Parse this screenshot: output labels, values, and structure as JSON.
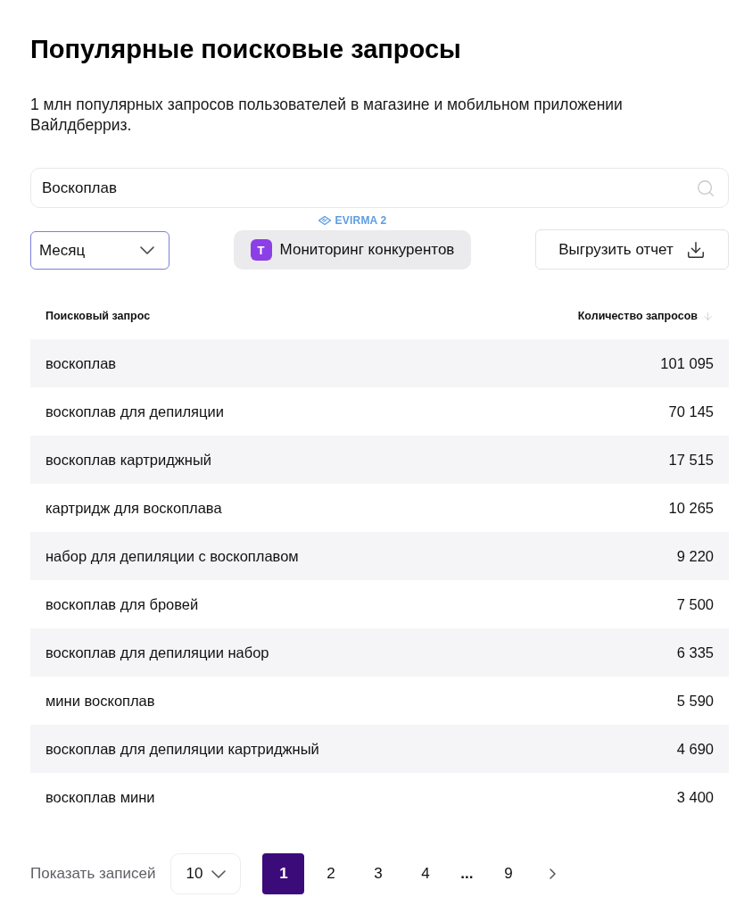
{
  "title": "Популярные поисковые запросы",
  "description": "1 млн популярных запросов пользователей в магазине и мобильном приложении Вайлдберриз.",
  "search": {
    "value": "Воскоплав"
  },
  "controls": {
    "period_select": {
      "value": "Месяц",
      "focused": true
    },
    "promo_label": "EVIRMA 2",
    "monitoring_button": {
      "badge": "T",
      "label": "Мониторинг конкурентов"
    },
    "export_button": {
      "label": "Выгрузить отчет"
    }
  },
  "table": {
    "columns": [
      {
        "label": "Поисковый запрос",
        "sorted": false
      },
      {
        "label": "Количество запросов",
        "sorted": true
      }
    ],
    "rows": [
      {
        "query": "воскоплав",
        "count": "101 095"
      },
      {
        "query": "воскоплав для депиляции",
        "count": "70 145"
      },
      {
        "query": "воскоплав картриджный",
        "count": "17 515"
      },
      {
        "query": "картридж для воскоплава",
        "count": "10 265"
      },
      {
        "query": "набор для депиляции с воскоплавом",
        "count": "9 220"
      },
      {
        "query": "воскоплав для бровей",
        "count": "7 500"
      },
      {
        "query": "воскоплав для депиляции набор",
        "count": "6 335"
      },
      {
        "query": "мини воскоплав",
        "count": "5 590"
      },
      {
        "query": "воскоплав для депиляции картриджный",
        "count": "4 690"
      },
      {
        "query": "воскоплав мини",
        "count": "3 400"
      }
    ]
  },
  "footer": {
    "page_size_label": "Показать записей",
    "page_size": "10",
    "pages": [
      {
        "kind": "page",
        "label": "1",
        "selected": true
      },
      {
        "kind": "page",
        "label": "2",
        "selected": false
      },
      {
        "kind": "page",
        "label": "3",
        "selected": false
      },
      {
        "kind": "page",
        "label": "4",
        "selected": false
      },
      {
        "kind": "ellipsis",
        "label": "..."
      },
      {
        "kind": "page",
        "label": "9",
        "selected": false
      }
    ]
  }
}
